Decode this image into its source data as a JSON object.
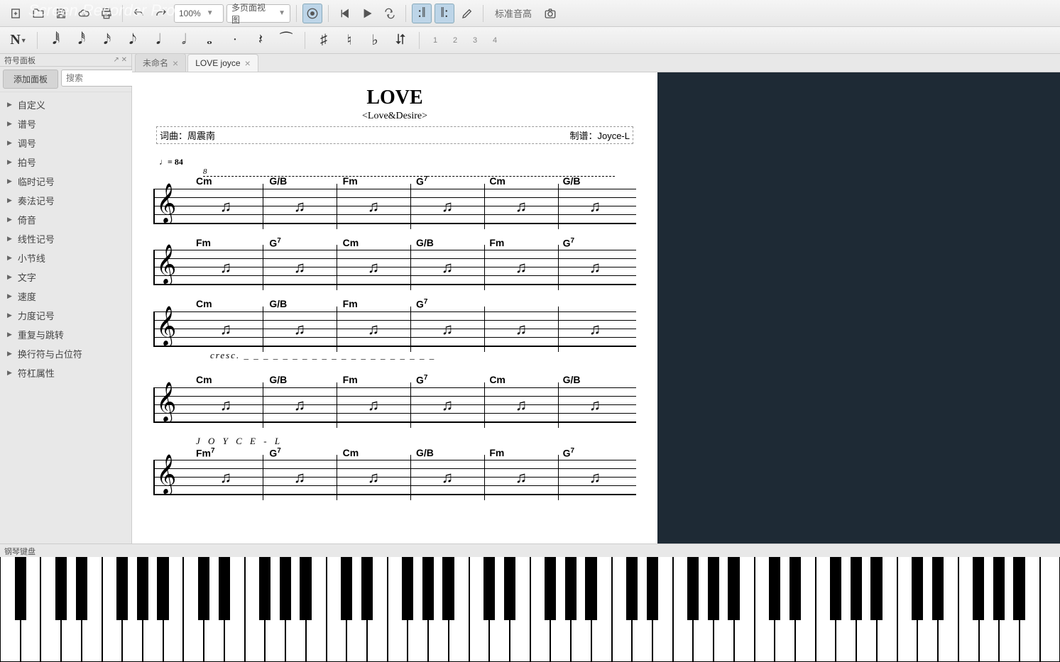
{
  "watermark": "Screen Recorder Pro",
  "toolbar1": {
    "zoom": "100%",
    "view_mode": "多页面视图",
    "pitch_label": "标准音高"
  },
  "toolbar2": {
    "voices": [
      "1",
      "2",
      "3",
      "4"
    ]
  },
  "sidebar": {
    "title": "符号面板",
    "add_btn": "添加面板",
    "search_placeholder": "搜索",
    "items": [
      "自定义",
      "谱号",
      "调号",
      "拍号",
      "临时记号",
      "奏法记号",
      "倚音",
      "线性记号",
      "小节线",
      "文字",
      "速度",
      "力度记号",
      "重复与跳转",
      "换行符与占位符",
      "符杠属性"
    ]
  },
  "tabs": [
    {
      "label": "未命名",
      "active": false
    },
    {
      "label": "LOVE joyce",
      "active": true
    }
  ],
  "score": {
    "title": "LOVE",
    "subtitle": "<Love&Desire>",
    "composer_label": "词曲：",
    "composer": "周震南",
    "arranger_label": "制谱：",
    "arranger": "Joyce-L",
    "tempo": "♩= 84",
    "ottava": "8",
    "cresc": "cresc. _ _ _ _ _ _ _ _ _ _ _ _ _ _ _ _ _ _ _ _",
    "joyce": "J O Y C E - L",
    "systems": [
      {
        "chords": [
          "Cm",
          "G/B",
          "Fm",
          "G⁷",
          "Cm",
          "G/B"
        ]
      },
      {
        "chords": [
          "Fm",
          "G⁷",
          "Cm",
          "G/B",
          "Fm",
          "G⁷"
        ]
      },
      {
        "chords": [
          "Cm",
          "G/B",
          "Fm",
          "G⁷",
          "",
          ""
        ]
      },
      {
        "chords": [
          "Cm",
          "G/B",
          "Fm",
          "G⁷",
          "Cm",
          "G/B"
        ]
      },
      {
        "chords": [
          "Fm⁷",
          "G⁷",
          "Cm",
          "G/B",
          "Fm",
          "G⁷"
        ]
      }
    ]
  },
  "piano": {
    "label": "钢琴键盘",
    "octaves": 8
  }
}
